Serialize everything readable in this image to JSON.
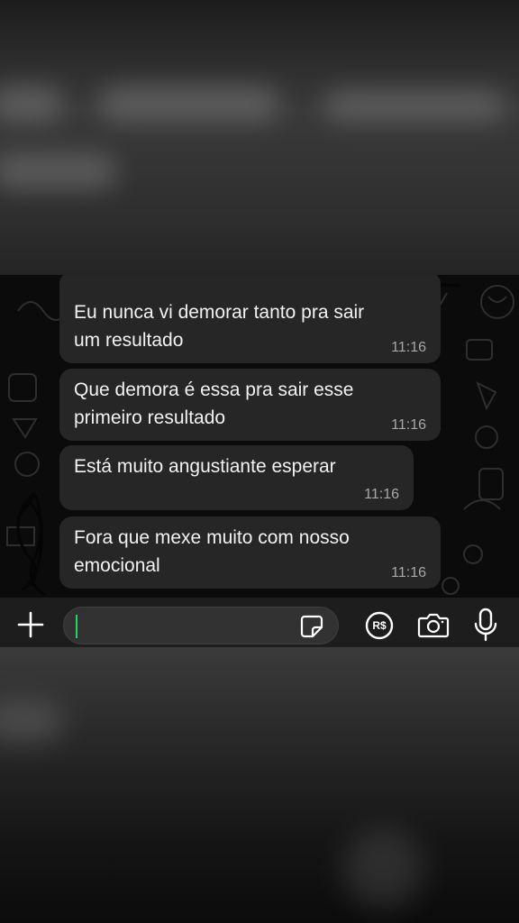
{
  "chat": {
    "messages": [
      {
        "text": "Eu nunca vi demorar tanto pra sair\num resultado",
        "time": "11:16"
      },
      {
        "text": "Que demora é essa pra sair esse\nprimeiro resultado",
        "time": "11:16"
      },
      {
        "text": "Está muito angustiante esperar",
        "time": "11:16"
      },
      {
        "text": "Fora que mexe muito com nosso\nemocional",
        "time": "11:16"
      }
    ]
  },
  "composer": {
    "value": "",
    "placeholder": "",
    "icons": [
      "plus-icon",
      "sticker-icon",
      "pix-payment-icon",
      "camera-icon",
      "microphone-icon"
    ],
    "pix_label": "R$"
  },
  "colors": {
    "bubble": "#262626",
    "chat_background": "#0b0b0b",
    "cursor": "#25d366",
    "timestamp": "#a8a8a8"
  }
}
